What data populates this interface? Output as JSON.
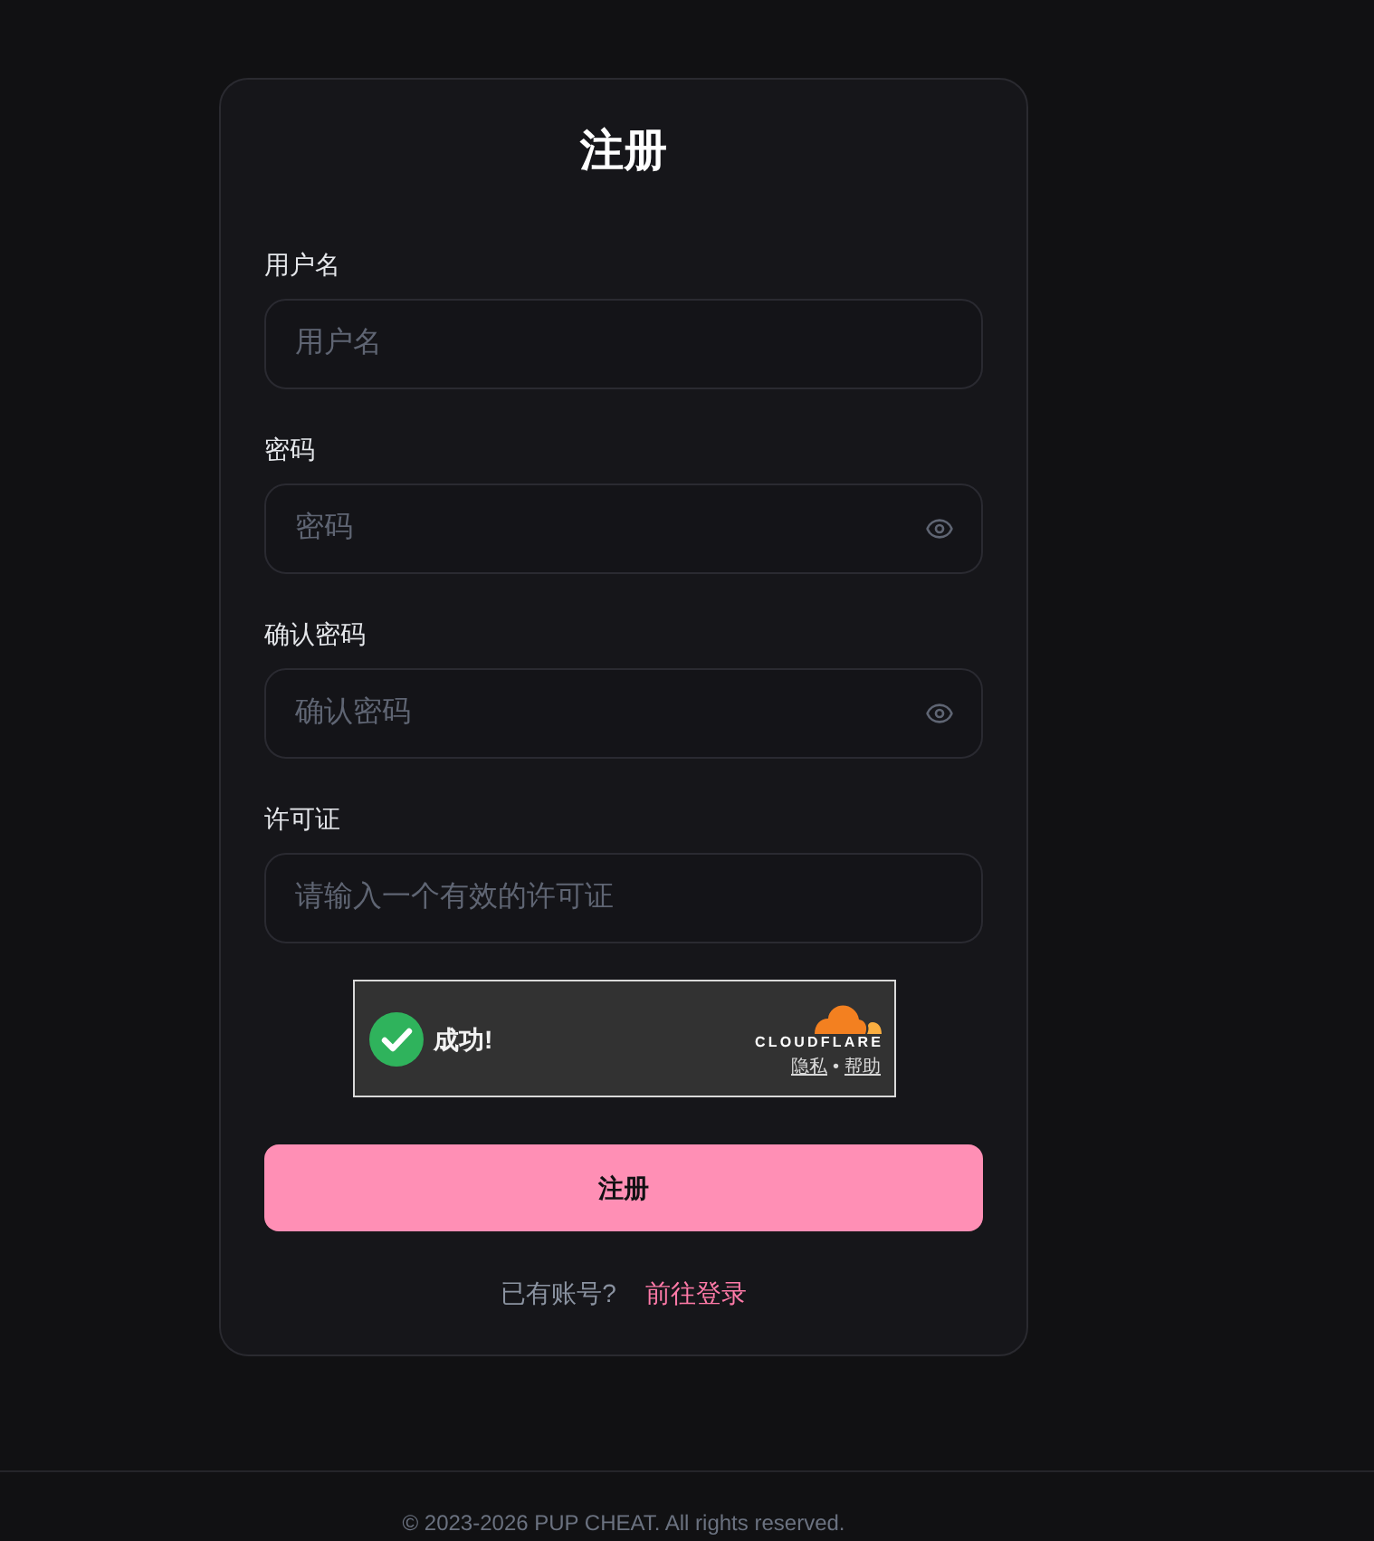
{
  "form": {
    "title": "注册",
    "fields": [
      {
        "label": "用户名",
        "placeholder": "用户名",
        "kind": "text"
      },
      {
        "label": "密码",
        "placeholder": "密码",
        "kind": "password"
      },
      {
        "label": "确认密码",
        "placeholder": "确认密码",
        "kind": "password"
      },
      {
        "label": "许可证",
        "placeholder": "请输入一个有效的许可证",
        "kind": "text"
      }
    ],
    "captcha": {
      "verified": true,
      "message": "成功!",
      "brand": "CLOUDFLARE",
      "links": [
        "隐私",
        "帮助"
      ],
      "separator": "•"
    },
    "submit": "注册",
    "login_prompt": {
      "text": "已有账号?",
      "link": "前往登录"
    }
  },
  "footer": {
    "copyright": "© 2023-2026 PUP CHEAT. All rights reserved."
  }
}
